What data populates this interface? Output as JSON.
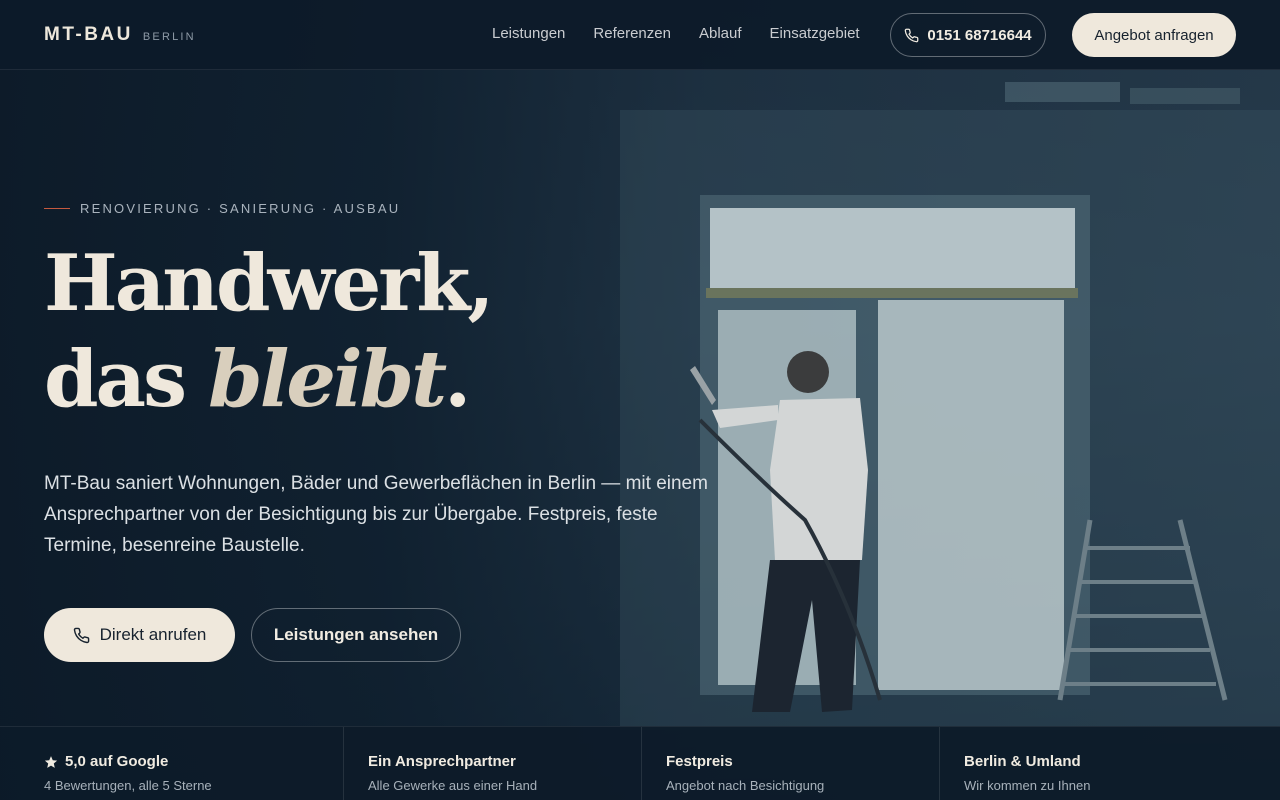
{
  "brand": {
    "name": "MT-BAU",
    "tagline": "BERLIN"
  },
  "nav": {
    "links": [
      "Leistungen",
      "Referenzen",
      "Ablauf",
      "Einsatzgebiet"
    ],
    "phone": "0151 68716644",
    "cta": "Angebot anfragen"
  },
  "hero": {
    "eyebrow": "RENOVIERUNG · SANIERUNG · AUSBAU",
    "headline_line1": "Handwerk,",
    "headline_line2_prefix": "das ",
    "headline_line2_emphasis": "bleibt",
    "headline_line2_suffix": ".",
    "lead": "MT-Bau saniert Wohnungen, Bäder und Gewerbeflächen in Berlin — mit einem Ansprechpartner von der Besichtigung bis zur Übergabe. Festpreis, feste Termine, besenreine Baustelle.",
    "btn_call": "Direkt anrufen",
    "btn_services": "Leistungen ansehen"
  },
  "trust": [
    {
      "title": "5,0 auf Google",
      "sub": "4 Bewertungen, alle 5 Sterne"
    },
    {
      "title": "Ein Ansprechpartner",
      "sub": "Alle Gewerke aus einer Hand"
    },
    {
      "title": "Festpreis",
      "sub": "Angebot nach Besichtigung"
    },
    {
      "title": "Berlin & Umland",
      "sub": "Wir kommen zu Ihnen"
    }
  ],
  "colors": {
    "background": "#0f1d2b",
    "cream": "#efe8dc",
    "accent_line": "#c4593f"
  },
  "icons": [
    "phone-icon",
    "star-icon"
  ]
}
